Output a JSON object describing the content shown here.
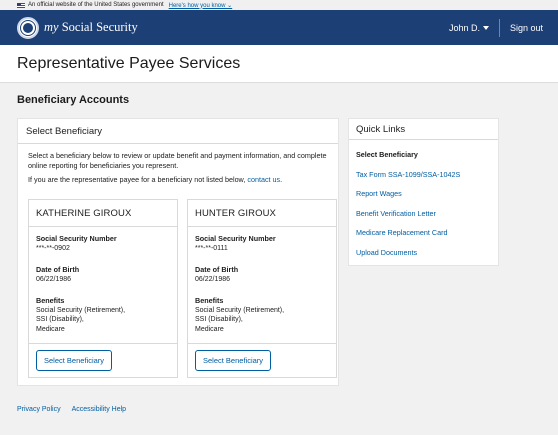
{
  "gov_banner": {
    "text": "An official website of the United States government",
    "link": "Here's how you know"
  },
  "header": {
    "brand_prefix": "my",
    "brand_name": "Social Security",
    "user": "John D.",
    "signout": "Sign out"
  },
  "page_title": "Representative Payee Services",
  "section_heading": "Beneficiary Accounts",
  "select_panel": {
    "title": "Select Beneficiary",
    "intro": "Select a beneficiary below to review or update benefit and payment information, and complete online reporting for beneficiaries you represent.",
    "intro2_prefix": "If you are the representative payee for a beneficiary not listed below, ",
    "contact_link": "contact us",
    "intro2_suffix": "."
  },
  "field_labels": {
    "ssn": "Social Security Number",
    "dob": "Date of Birth",
    "benefits": "Benefits"
  },
  "beneficiaries": [
    {
      "name": "KATHERINE GIROUX",
      "ssn": "***-**-0902",
      "dob": "06/22/1986",
      "benefits": [
        "Social Security (Retirement),",
        "SSI (Disability),",
        "Medicare"
      ],
      "button": "Select Beneficiary"
    },
    {
      "name": "HUNTER GIROUX",
      "ssn": "***-**-0111",
      "dob": "06/22/1986",
      "benefits": [
        "Social Security (Retirement),",
        "SSI (Disability),",
        "Medicare"
      ],
      "button": "Select Beneficiary"
    }
  ],
  "quick_links": {
    "title": "Quick Links",
    "items": [
      "Select Beneficiary",
      "Tax Form SSA-1099/SSA-1042S",
      "Report Wages",
      "Benefit Verification Letter",
      "Medicare Replacement Card",
      "Upload Documents"
    ]
  },
  "footer": {
    "privacy": "Privacy Policy",
    "accessibility": "Accessibility Help"
  },
  "colors": {
    "header_bg": "#1c3f75",
    "link": "#005ea2",
    "page_bg": "#f1f1f1"
  }
}
